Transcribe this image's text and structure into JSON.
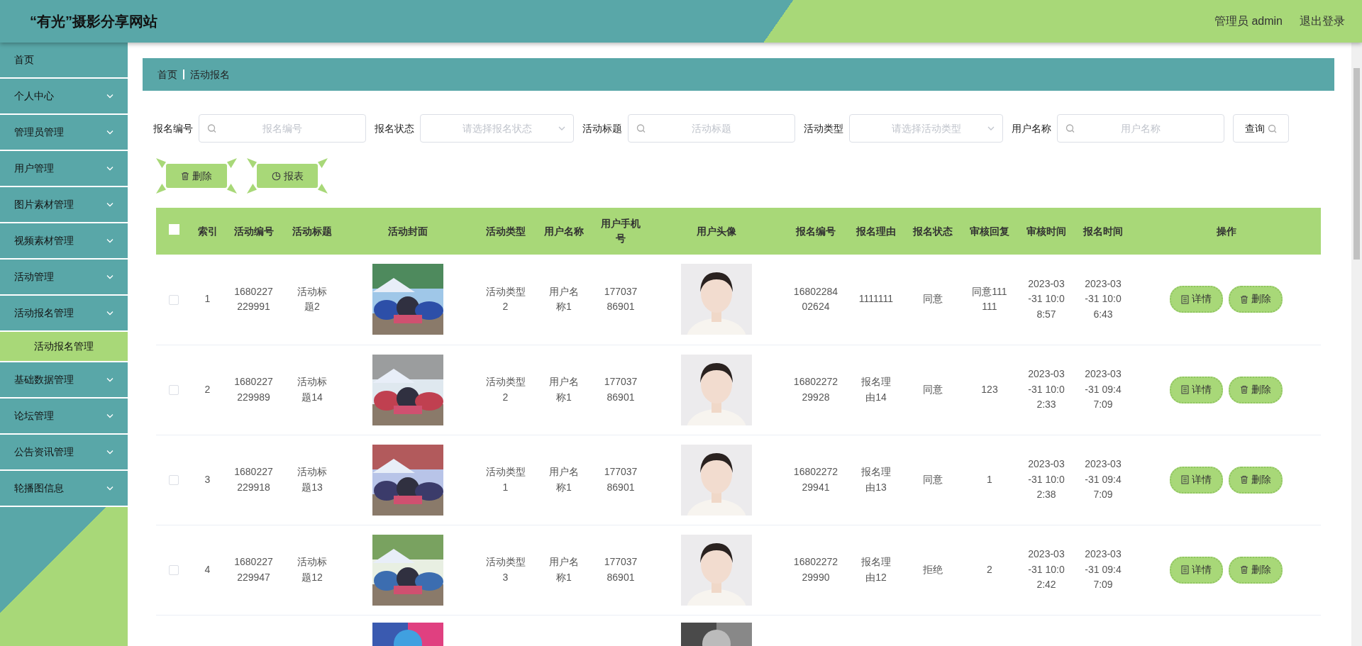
{
  "header": {
    "title": "“有光”摄影分享网站",
    "user": "管理员 admin",
    "logout": "退出登录"
  },
  "sidebar": {
    "items": [
      {
        "label": "首页",
        "expandable": false
      },
      {
        "label": "个人中心",
        "expandable": true,
        "expanded": false
      },
      {
        "label": "管理员管理",
        "expandable": true,
        "expanded": false
      },
      {
        "label": "用户管理",
        "expandable": true,
        "expanded": false
      },
      {
        "label": "图片素材管理",
        "expandable": true,
        "expanded": false
      },
      {
        "label": "视频素材管理",
        "expandable": true,
        "expanded": false
      },
      {
        "label": "活动管理",
        "expandable": true,
        "expanded": false
      },
      {
        "label": "活动报名管理",
        "expandable": true,
        "expanded": true,
        "children": [
          {
            "label": "活动报名管理",
            "selected": true
          }
        ]
      },
      {
        "label": "基础数据管理",
        "expandable": true,
        "expanded": false
      },
      {
        "label": "论坛管理",
        "expandable": true,
        "expanded": false
      },
      {
        "label": "公告资讯管理",
        "expandable": true,
        "expanded": false
      },
      {
        "label": "轮播图信息",
        "expandable": true,
        "expanded": false
      }
    ]
  },
  "breadcrumb": [
    "首页",
    "活动报名"
  ],
  "filters": [
    {
      "kind": "text",
      "label": "报名编号",
      "placeholder": "报名编号"
    },
    {
      "kind": "select",
      "label": "报名状态",
      "placeholder": "请选择报名状态"
    },
    {
      "kind": "text",
      "label": "活动标题",
      "placeholder": "活动标题"
    },
    {
      "kind": "select",
      "label": "活动类型",
      "placeholder": "请选择活动类型"
    },
    {
      "kind": "text",
      "label": "用户名称",
      "placeholder": "用户名称"
    }
  ],
  "search_button": "查询",
  "toolbar": [
    "删除",
    "报表"
  ],
  "table": {
    "select_all_checked": false,
    "columns": [
      {
        "label": "索引",
        "kind": "text"
      },
      {
        "label": "活动编号",
        "kind": "text"
      },
      {
        "label": "活动标题",
        "kind": "text"
      },
      {
        "label": "活动封面",
        "kind": "picture"
      },
      {
        "label": "活动类型",
        "kind": "text"
      },
      {
        "label": "用户名称",
        "kind": "text"
      },
      {
        "label": "用户手机号",
        "kind": "text"
      },
      {
        "label": "用户头像",
        "kind": "avatar"
      },
      {
        "label": "报名编号",
        "kind": "text"
      },
      {
        "label": "报名理由",
        "kind": "text"
      },
      {
        "label": "报名状态",
        "kind": "text"
      },
      {
        "label": "审核回复",
        "kind": "text"
      },
      {
        "label": "审核时间",
        "kind": "text"
      },
      {
        "label": "报名时间",
        "kind": "text"
      },
      {
        "label": "操作",
        "kind": "actions"
      }
    ],
    "rows": [
      {
        "kind": "data",
        "checked": false,
        "cells": [
          "1",
          "1680227229991",
          "活动标题2",
          "活动类型2",
          "用户名称1",
          "17703786901",
          "1680228402624",
          "1111111",
          "同意",
          "同意111111",
          "2023-03-31 10:08:57",
          "2023-03-31 10:06:43"
        ],
        "actions": [
          "详情",
          "删除"
        ]
      },
      {
        "kind": "data",
        "checked": false,
        "cells": [
          "2",
          "1680227229989",
          "活动标题14",
          "活动类型2",
          "用户名称1",
          "17703786901",
          "1680227229928",
          "报名理由14",
          "同意",
          "123",
          "2023-03-31 10:02:33",
          "2023-03-31 09:47:09"
        ],
        "actions": [
          "详情",
          "删除"
        ]
      },
      {
        "kind": "data",
        "checked": false,
        "cells": [
          "3",
          "1680227229918",
          "活动标题13",
          "活动类型1",
          "用户名称1",
          "17703786901",
          "1680227229941",
          "报名理由13",
          "同意",
          "1",
          "2023-03-31 10:02:38",
          "2023-03-31 09:47:09"
        ],
        "actions": [
          "详情",
          "删除"
        ]
      },
      {
        "kind": "data",
        "checked": false,
        "cells": [
          "4",
          "1680227229947",
          "活动标题12",
          "活动类型3",
          "用户名称1",
          "17703786901",
          "1680227229990",
          "报名理由12",
          "拒绝",
          "2",
          "2023-03-31 10:02:42",
          "2023-03-31 09:47:09"
        ],
        "actions": [
          "详情",
          "删除"
        ]
      },
      {
        "kind": "cut"
      }
    ]
  }
}
